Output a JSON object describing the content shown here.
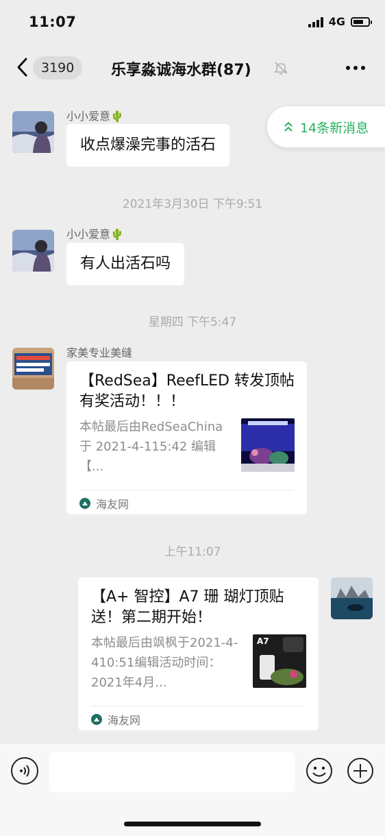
{
  "status_bar": {
    "time": "11:07",
    "network": "4G",
    "battery_level": 0.7
  },
  "nav": {
    "back_count": "3190",
    "title": "乐享淼诚海水群(87)"
  },
  "new_messages": {
    "label": "14条新消息"
  },
  "messages": [
    {
      "sender": "小小爱意🌵",
      "text": "收点爆澡完事的活石"
    },
    {
      "sender": "小小爱意🌵",
      "text": "有人出活石吗"
    },
    {
      "sender": "家美专业美缝",
      "card": {
        "title": "【RedSea】ReefLED 转发顶帖有奖活动！！！",
        "desc": "本帖最后由RedSeaChina 于 2021-4-115:42 编辑【...",
        "source": "海友网"
      }
    },
    {
      "sender": "",
      "card": {
        "title": "【A+ 智控】A7 珊 瑚灯顶贴送！第二期开始！",
        "desc": "本帖最后由飒枫于2021-4-410:51编辑活动时间：2021年4月...",
        "source": "海友网",
        "thumb_label": "A7"
      }
    }
  ],
  "timestamps": [
    "2021年3月30日 下午9:51",
    "星期四 下午5:47",
    "上午11:07"
  ],
  "input": {
    "placeholder": ""
  },
  "colors": {
    "accent": "#23b35b",
    "background": "#ededed",
    "bubble": "#ffffff"
  }
}
